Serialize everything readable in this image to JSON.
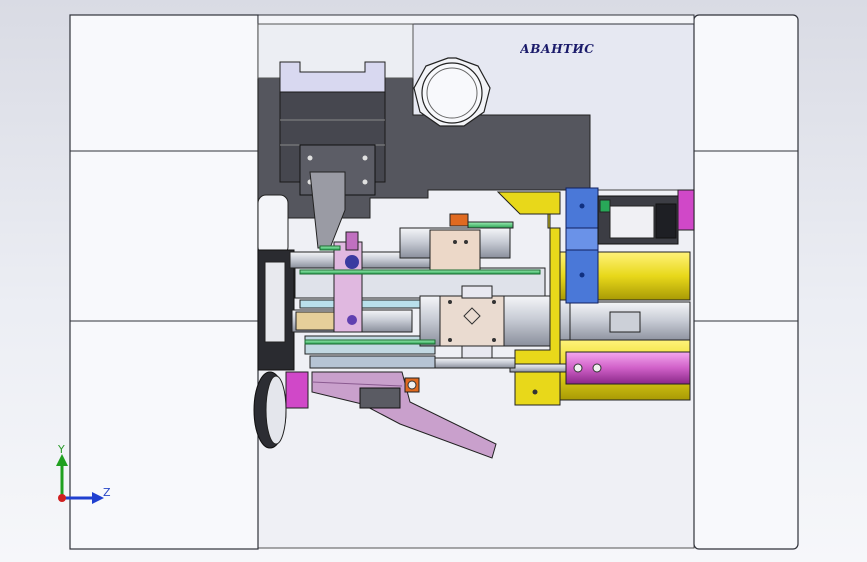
{
  "brand_label": "АВАНТИС",
  "triad": {
    "y_label": "Y",
    "z_label": "Z",
    "y_color": "#20a020",
    "z_color": "#2040d0",
    "x_color": "#d02020"
  },
  "colors": {
    "background_top": "#d9dbe4",
    "background_bottom": "#f6f7fa",
    "panel_fill": "#f8f9fc",
    "panel_stroke": "#30323a",
    "dark_housing": "#55565e",
    "yellow_part": "#e8d81a",
    "blue_block": "#4a78d8",
    "magenta_part": "#d060c8",
    "pink_lever": "#c9a0cc",
    "green_rod": "#36c060",
    "steel": "#c8ccd4"
  }
}
